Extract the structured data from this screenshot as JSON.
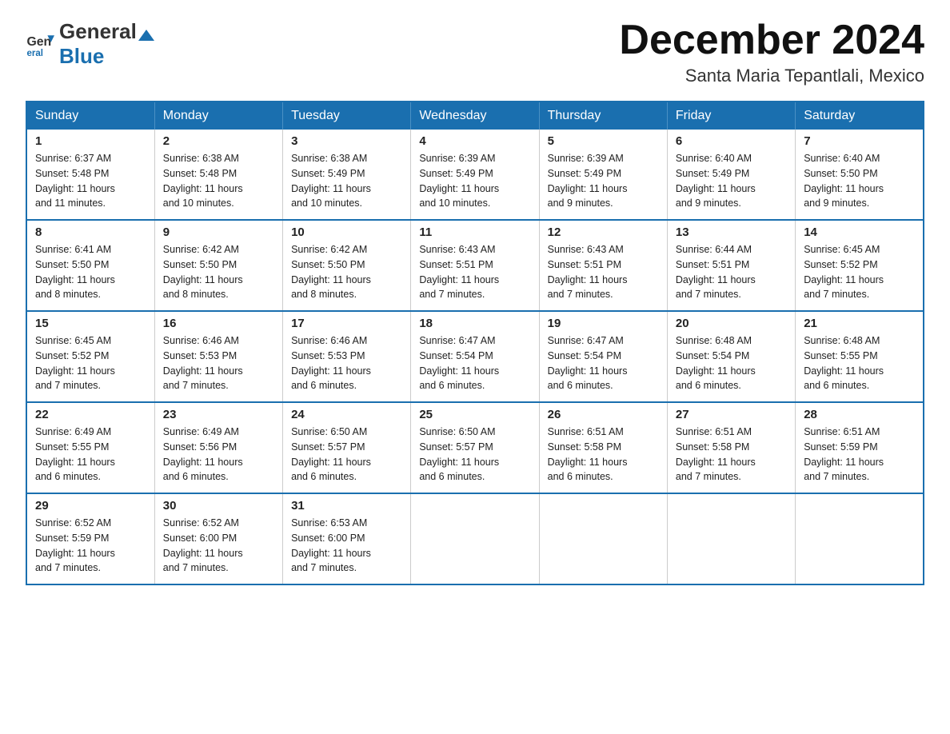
{
  "header": {
    "logo_general": "General",
    "logo_blue": "Blue",
    "month_title": "December 2024",
    "location": "Santa Maria Tepantlali, Mexico"
  },
  "weekdays": [
    "Sunday",
    "Monday",
    "Tuesday",
    "Wednesday",
    "Thursday",
    "Friday",
    "Saturday"
  ],
  "weeks": [
    [
      {
        "day": "1",
        "sunrise": "6:37 AM",
        "sunset": "5:48 PM",
        "daylight": "11 hours and 11 minutes."
      },
      {
        "day": "2",
        "sunrise": "6:38 AM",
        "sunset": "5:48 PM",
        "daylight": "11 hours and 10 minutes."
      },
      {
        "day": "3",
        "sunrise": "6:38 AM",
        "sunset": "5:49 PM",
        "daylight": "11 hours and 10 minutes."
      },
      {
        "day": "4",
        "sunrise": "6:39 AM",
        "sunset": "5:49 PM",
        "daylight": "11 hours and 10 minutes."
      },
      {
        "day": "5",
        "sunrise": "6:39 AM",
        "sunset": "5:49 PM",
        "daylight": "11 hours and 9 minutes."
      },
      {
        "day": "6",
        "sunrise": "6:40 AM",
        "sunset": "5:49 PM",
        "daylight": "11 hours and 9 minutes."
      },
      {
        "day": "7",
        "sunrise": "6:40 AM",
        "sunset": "5:50 PM",
        "daylight": "11 hours and 9 minutes."
      }
    ],
    [
      {
        "day": "8",
        "sunrise": "6:41 AM",
        "sunset": "5:50 PM",
        "daylight": "11 hours and 8 minutes."
      },
      {
        "day": "9",
        "sunrise": "6:42 AM",
        "sunset": "5:50 PM",
        "daylight": "11 hours and 8 minutes."
      },
      {
        "day": "10",
        "sunrise": "6:42 AM",
        "sunset": "5:50 PM",
        "daylight": "11 hours and 8 minutes."
      },
      {
        "day": "11",
        "sunrise": "6:43 AM",
        "sunset": "5:51 PM",
        "daylight": "11 hours and 7 minutes."
      },
      {
        "day": "12",
        "sunrise": "6:43 AM",
        "sunset": "5:51 PM",
        "daylight": "11 hours and 7 minutes."
      },
      {
        "day": "13",
        "sunrise": "6:44 AM",
        "sunset": "5:51 PM",
        "daylight": "11 hours and 7 minutes."
      },
      {
        "day": "14",
        "sunrise": "6:45 AM",
        "sunset": "5:52 PM",
        "daylight": "11 hours and 7 minutes."
      }
    ],
    [
      {
        "day": "15",
        "sunrise": "6:45 AM",
        "sunset": "5:52 PM",
        "daylight": "11 hours and 7 minutes."
      },
      {
        "day": "16",
        "sunrise": "6:46 AM",
        "sunset": "5:53 PM",
        "daylight": "11 hours and 7 minutes."
      },
      {
        "day": "17",
        "sunrise": "6:46 AM",
        "sunset": "5:53 PM",
        "daylight": "11 hours and 6 minutes."
      },
      {
        "day": "18",
        "sunrise": "6:47 AM",
        "sunset": "5:54 PM",
        "daylight": "11 hours and 6 minutes."
      },
      {
        "day": "19",
        "sunrise": "6:47 AM",
        "sunset": "5:54 PM",
        "daylight": "11 hours and 6 minutes."
      },
      {
        "day": "20",
        "sunrise": "6:48 AM",
        "sunset": "5:54 PM",
        "daylight": "11 hours and 6 minutes."
      },
      {
        "day": "21",
        "sunrise": "6:48 AM",
        "sunset": "5:55 PM",
        "daylight": "11 hours and 6 minutes."
      }
    ],
    [
      {
        "day": "22",
        "sunrise": "6:49 AM",
        "sunset": "5:55 PM",
        "daylight": "11 hours and 6 minutes."
      },
      {
        "day": "23",
        "sunrise": "6:49 AM",
        "sunset": "5:56 PM",
        "daylight": "11 hours and 6 minutes."
      },
      {
        "day": "24",
        "sunrise": "6:50 AM",
        "sunset": "5:57 PM",
        "daylight": "11 hours and 6 minutes."
      },
      {
        "day": "25",
        "sunrise": "6:50 AM",
        "sunset": "5:57 PM",
        "daylight": "11 hours and 6 minutes."
      },
      {
        "day": "26",
        "sunrise": "6:51 AM",
        "sunset": "5:58 PM",
        "daylight": "11 hours and 6 minutes."
      },
      {
        "day": "27",
        "sunrise": "6:51 AM",
        "sunset": "5:58 PM",
        "daylight": "11 hours and 7 minutes."
      },
      {
        "day": "28",
        "sunrise": "6:51 AM",
        "sunset": "5:59 PM",
        "daylight": "11 hours and 7 minutes."
      }
    ],
    [
      {
        "day": "29",
        "sunrise": "6:52 AM",
        "sunset": "5:59 PM",
        "daylight": "11 hours and 7 minutes."
      },
      {
        "day": "30",
        "sunrise": "6:52 AM",
        "sunset": "6:00 PM",
        "daylight": "11 hours and 7 minutes."
      },
      {
        "day": "31",
        "sunrise": "6:53 AM",
        "sunset": "6:00 PM",
        "daylight": "11 hours and 7 minutes."
      },
      null,
      null,
      null,
      null
    ]
  ],
  "labels": {
    "sunrise": "Sunrise:",
    "sunset": "Sunset:",
    "daylight": "Daylight:"
  }
}
